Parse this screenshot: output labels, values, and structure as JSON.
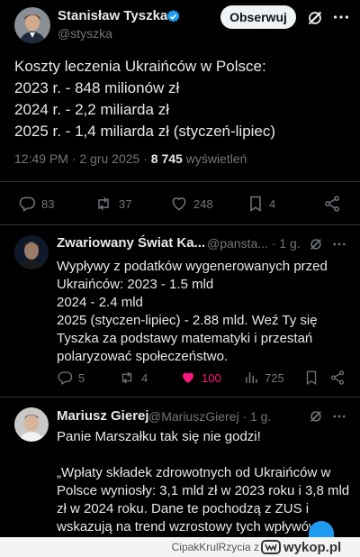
{
  "main_tweet": {
    "author_name": "Stanisław Tyszka",
    "author_handle": "@styszka",
    "follow_label": "Obserwuj",
    "text_lines": [
      "Koszty leczenia Ukraińców w Polsce:",
      "2023 r. - 848 milionów zł",
      "2024 r. - 2,2 miliarda zł",
      "2025 r. - 1,4 miliarda zł (styczeń-lipiec)"
    ],
    "time": "12:49 PM · 2 gru 2025 · ",
    "views_count": "8 745",
    "views_label": " wyświetleń",
    "stats": {
      "replies": "83",
      "reposts": "37",
      "likes": "248",
      "bookmarks": "4"
    }
  },
  "replies": [
    {
      "author_name": "Zwariowany Świat Ka...",
      "author_handle": "@pansta... · 1 g.",
      "text_lines": [
        "Wypływy z podatków wygenerowanych przed",
        "Ukraińców: 2023 - 1.5 mld",
        "2024 - 2.4 mld",
        "2025 (styczen-lipiec) - 2.88 mld. Weź Ty się",
        "Tyszka za podstawy matematyki i przestań",
        "polaryzować społeczeństwo."
      ],
      "stats": {
        "replies": "5",
        "reposts": "4",
        "likes": "100",
        "views": "725"
      }
    },
    {
      "author_name": "Mariusz Gierej",
      "author_handle": "@MariuszGierej · 1 g.",
      "text_lines": [
        "Panie Marszałku tak się nie godzi!",
        "",
        "„Wpłaty składek zdrowotnych od Ukraińców w",
        "Polsce wyniosły: 3,1 mld zł w 2023 roku i 3,8 mld",
        "zł w 2024 roku. Dane te pochodzą z ZUS i",
        "wskazują na trend wzrostowy tych wpływów.”"
      ]
    }
  ],
  "footer": {
    "user": "CipakKrulRzycia",
    "separator": "z",
    "brand": "wykop.pl"
  },
  "colors": {
    "accent": "#1d9bf0",
    "like": "#f91880",
    "background": "#000000",
    "muted": "#71767b"
  },
  "icons": [
    "verified-icon",
    "grok-icon",
    "more-icon",
    "reply-icon",
    "repost-icon",
    "like-icon",
    "bookmark-icon",
    "share-icon",
    "views-icon"
  ]
}
